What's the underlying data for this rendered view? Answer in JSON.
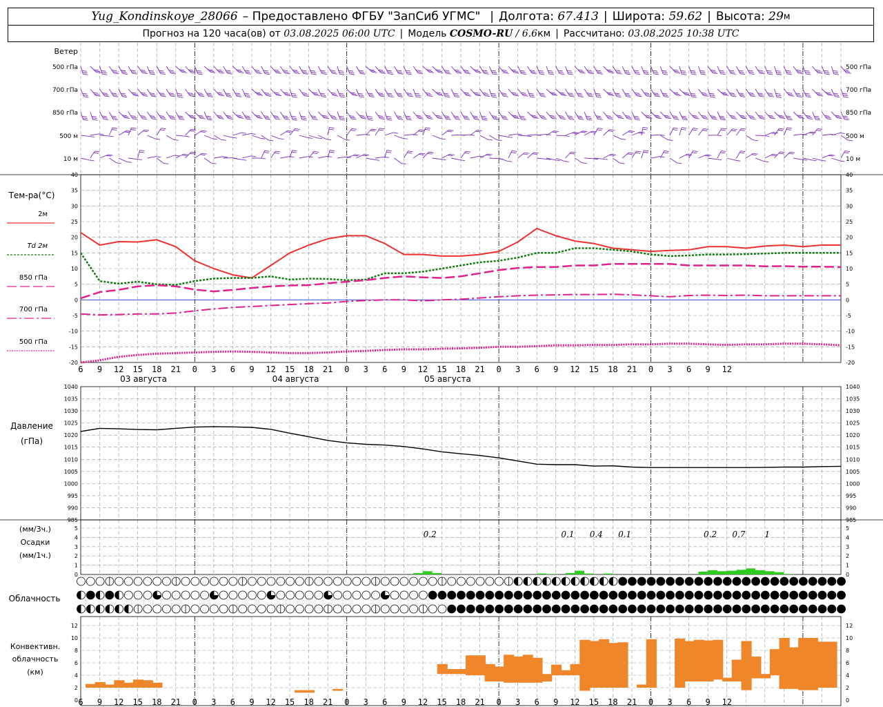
{
  "header": {
    "station": "Yug_Kondinskoye_28066",
    "provider_text": "– Предоставлено ФГБУ \"ЗапСиб УГМС\"",
    "lon_label": "Долгота:",
    "lon_value": "67.413",
    "lat_label": "Широта:",
    "lat_value": "59.62",
    "alt_label": "Высота:",
    "alt_value": "29",
    "alt_unit": "м",
    "forecast_prefix": "Прогноз на 120 часа(ов) от",
    "forecast_start": "03.08.2025 06:00 UTC",
    "model_label": "Модель",
    "model_name": "COSMO-RU",
    "model_res": "/ 6.6",
    "model_res_unit": "км",
    "calc_label": "Рассчитано:",
    "calc_time": "03.08.2025 10:38 UTC"
  },
  "chart_data": [
    {
      "type": "wind_barbs",
      "panel_label": "Ветер",
      "levels": [
        "500 гПа",
        "700 гПа",
        "850 гПа",
        "500 м",
        "10 м"
      ],
      "barb_color": "#7b2fbe"
    },
    {
      "type": "line",
      "ylabel": "Тем-ра(°C)",
      "ylim": [
        -20,
        40
      ],
      "yticks": [
        -20,
        -15,
        -10,
        -5,
        0,
        5,
        10,
        15,
        20,
        25,
        30,
        35,
        40
      ],
      "x_hours": [
        0,
        3,
        6,
        9,
        12,
        15,
        18,
        21,
        24,
        27,
        30,
        33,
        36,
        39,
        42,
        45,
        48,
        51,
        54,
        57,
        60,
        63,
        66,
        69,
        72,
        75,
        78,
        81,
        84,
        87,
        90,
        93,
        96,
        99,
        102,
        105,
        108,
        111,
        114,
        117,
        120
      ],
      "series": [
        {
          "name": "2м",
          "color": "#ee3030",
          "style": "solid",
          "values": [
            21.5,
            17.5,
            18.6,
            18.5,
            19.2,
            17,
            12.5,
            10,
            8,
            7,
            11,
            15,
            17.5,
            19.5,
            20.5,
            20.5,
            18,
            14.5,
            14.5,
            14,
            14,
            14.5,
            15.5,
            18.5,
            22.8,
            20.5,
            18.8,
            18,
            16.5,
            16,
            15.5,
            15.8,
            16,
            17,
            17,
            16.5,
            17.2,
            17.5,
            17,
            17.5,
            17.5
          ]
        },
        {
          "name": "Td 2м",
          "color": "#127a12",
          "style": "dotted",
          "values": [
            15,
            6,
            5.2,
            5.8,
            5,
            4.8,
            6,
            6.8,
            7,
            7,
            7.5,
            6.5,
            6.8,
            6.7,
            6.3,
            6.5,
            8.5,
            8.5,
            9,
            10,
            11,
            12,
            12.5,
            13.5,
            15,
            15,
            16.5,
            16.5,
            16,
            15.5,
            14.5,
            14,
            14.2,
            14.5,
            14.5,
            14.6,
            14.8,
            15,
            15,
            15,
            15
          ]
        },
        {
          "name": "850 гПа",
          "color": "#e0208c",
          "style": "dash",
          "values": [
            0.5,
            2.5,
            3.2,
            4.3,
            4.7,
            4.3,
            3.3,
            2.7,
            3.2,
            3.8,
            4.3,
            4.6,
            4.7,
            5.3,
            5.8,
            6.3,
            7,
            7.5,
            7.2,
            7,
            7.5,
            8.5,
            9.5,
            10.2,
            10.5,
            10.5,
            11,
            11,
            11.5,
            11.5,
            11.5,
            11.5,
            11,
            11,
            11,
            11,
            10.7,
            10.8,
            10.6,
            10.6,
            10.5
          ]
        },
        {
          "name": "700 гПа",
          "color": "#e0208c",
          "style": "dashdot",
          "values": [
            -4.5,
            -4.8,
            -4.7,
            -4.5,
            -4.5,
            -4.2,
            -3.5,
            -2.9,
            -2.4,
            -2.1,
            -1.8,
            -1.5,
            -1.2,
            -1,
            -0.5,
            -0.2,
            0,
            0,
            -0.3,
            0,
            0.2,
            0.6,
            1,
            1.3,
            1.5,
            1.6,
            1.7,
            1.7,
            1.8,
            1.6,
            1.3,
            1,
            1.4,
            1.5,
            1.4,
            1.5,
            1.3,
            1.3,
            1.3,
            1.3,
            1.3
          ]
        },
        {
          "name": "500 гПа",
          "color": "#e0208c",
          "style": "dense_dots",
          "values": [
            -20,
            -19.3,
            -18.2,
            -17.6,
            -17.2,
            -17,
            -16.8,
            -16.6,
            -16.5,
            -16.6,
            -16.8,
            -17,
            -17,
            -16.8,
            -16.5,
            -16.3,
            -16,
            -15.8,
            -15.8,
            -15.6,
            -15.5,
            -15.3,
            -15,
            -15,
            -14.8,
            -14.5,
            -14.5,
            -14.4,
            -14.4,
            -14.2,
            -14.2,
            -14,
            -14,
            -14.2,
            -14.4,
            -14.2,
            -14.2,
            -14,
            -14,
            -14.2,
            -14.5
          ]
        }
      ]
    },
    {
      "type": "line",
      "ylabel": "Давление (гПа)",
      "ylim": [
        985,
        1040
      ],
      "yticks": [
        985,
        990,
        995,
        1000,
        1005,
        1010,
        1015,
        1020,
        1025,
        1030,
        1035,
        1040
      ],
      "series": [
        {
          "name": "Давление",
          "color": "#000000",
          "style": "solid",
          "values": [
            1021.5,
            1022.8,
            1022.6,
            1022.3,
            1022.2,
            1022.8,
            1023.3,
            1023.5,
            1023.4,
            1023.2,
            1022.4,
            1020.8,
            1019.3,
            1017.8,
            1016.8,
            1016.2,
            1015.9,
            1015.3,
            1014.3,
            1013.1,
            1012.3,
            1011.6,
            1010.6,
            1009.3,
            1008,
            1007.8,
            1007.8,
            1007.2,
            1007.3,
            1006.8,
            1006.6,
            1006.6,
            1006.6,
            1006.6,
            1006.6,
            1006.6,
            1006.7,
            1006.8,
            1006.8,
            1007,
            1007.1
          ]
        }
      ]
    },
    {
      "type": "bar",
      "ylabel_top": "(мм/3ч.)",
      "ylabel_mid": "Осадки",
      "ylabel_bot": "(мм/1ч.)",
      "ylim": [
        0,
        5
      ],
      "yticks": [
        0,
        1,
        2,
        3,
        4,
        5
      ],
      "color": "#2ecc1e",
      "totals": [
        {
          "hour": 73.5,
          "label": "0.2"
        },
        {
          "hour": 102.5,
          "label": "0.1"
        },
        {
          "hour": 108.5,
          "label": "0.4"
        },
        {
          "hour": 114.5,
          "label": "0.1"
        },
        {
          "hour": 132.5,
          "label": "0.2"
        },
        {
          "hour": 138.5,
          "label": "0.7"
        },
        {
          "hour": 144.5,
          "label": "1"
        }
      ],
      "bars": [
        [
          70,
          0.15
        ],
        [
          72,
          0.35
        ],
        [
          74,
          0.15
        ],
        [
          96,
          0.1
        ],
        [
          98,
          0.05
        ],
        [
          102,
          0.15
        ],
        [
          104,
          0.4
        ],
        [
          106,
          0.1
        ],
        [
          110,
          0.1
        ],
        [
          130,
          0.3
        ],
        [
          132,
          0.45
        ],
        [
          134,
          0.35
        ],
        [
          136,
          0.4
        ],
        [
          138,
          0.5
        ],
        [
          140,
          0.65
        ],
        [
          142,
          0.45
        ],
        [
          144,
          0.35
        ],
        [
          146,
          0.25
        ],
        [
          148,
          0.05
        ]
      ]
    },
    {
      "type": "cloud_cover",
      "label": "Облачность",
      "rows": 3,
      "symbol_fill": "#000000"
    },
    {
      "type": "bar",
      "ylabel_1": "Конвективн.",
      "ylabel_2": "облачность",
      "ylabel_3": "(км)",
      "ylim": [
        0,
        13
      ],
      "yticks": [
        0,
        2,
        4,
        6,
        8,
        10,
        12
      ],
      "color": "#f0862a",
      "ranges": [
        [
          0,
          2,
          2.6
        ],
        [
          1,
          2,
          2.9
        ],
        [
          2,
          2,
          2.5
        ],
        [
          3,
          2,
          3.2
        ],
        [
          4,
          2,
          2.8
        ],
        [
          5,
          2,
          3.3
        ],
        [
          6,
          2,
          3.2
        ],
        [
          7,
          2,
          2.8
        ],
        [
          22,
          1.2,
          1.6
        ],
        [
          23,
          1.2,
          1.6
        ],
        [
          26,
          1.5,
          1.8
        ],
        [
          37,
          4.2,
          5.8
        ],
        [
          38,
          4.2,
          5
        ],
        [
          39,
          4.2,
          5
        ],
        [
          40,
          4,
          7.2
        ],
        [
          41,
          4,
          7.2
        ],
        [
          42,
          3,
          5.8
        ],
        [
          43,
          3,
          5.4
        ],
        [
          44,
          2.8,
          7.3
        ],
        [
          45,
          2.8,
          7
        ],
        [
          46,
          2.8,
          7.3
        ],
        [
          47,
          2.8,
          6.8
        ],
        [
          48,
          3,
          4.2
        ],
        [
          49,
          4,
          5.7
        ],
        [
          50,
          4,
          4.8
        ],
        [
          51,
          4,
          5.8
        ],
        [
          52,
          1.5,
          9.7
        ],
        [
          53,
          2,
          9.5
        ],
        [
          54,
          2,
          9.8
        ],
        [
          55,
          2,
          9.2
        ],
        [
          56,
          2,
          9.3
        ],
        [
          58,
          2,
          2.5
        ],
        [
          59,
          2,
          9.8
        ],
        [
          62,
          2,
          9.9
        ],
        [
          63,
          3,
          9.5
        ],
        [
          64,
          3,
          9.7
        ],
        [
          65,
          3,
          9.6
        ],
        [
          66,
          3.3,
          9.7
        ],
        [
          67,
          3,
          3.6
        ],
        [
          68,
          3,
          6.5
        ],
        [
          69,
          1.6,
          9.5
        ],
        [
          70,
          3.5,
          7
        ],
        [
          71,
          3.5,
          4.2
        ],
        [
          72,
          4,
          8.2
        ],
        [
          73,
          1.8,
          10
        ],
        [
          74,
          1.8,
          8.5
        ],
        [
          75,
          1.6,
          10
        ],
        [
          76,
          1.6,
          10
        ],
        [
          77,
          2,
          9.4
        ],
        [
          78,
          2,
          9.4
        ]
      ]
    }
  ],
  "x_axis": {
    "tick_labels": [
      "6",
      "9",
      "12",
      "15",
      "18",
      "21",
      "0",
      "3",
      "6",
      "9",
      "12",
      "15",
      "18",
      "21",
      "0",
      "3",
      "6",
      "9",
      "12",
      "15",
      "18",
      "21",
      "0",
      "3",
      "6",
      "9",
      "12",
      "15",
      "18",
      "21",
      "0",
      "3",
      "6",
      "9",
      "12"
    ],
    "date_labels": [
      {
        "hour": 6,
        "label": "03 августа"
      },
      {
        "hour": 30,
        "label": "04 августа"
      },
      {
        "hour": 54,
        "label": "05 августа"
      }
    ]
  }
}
